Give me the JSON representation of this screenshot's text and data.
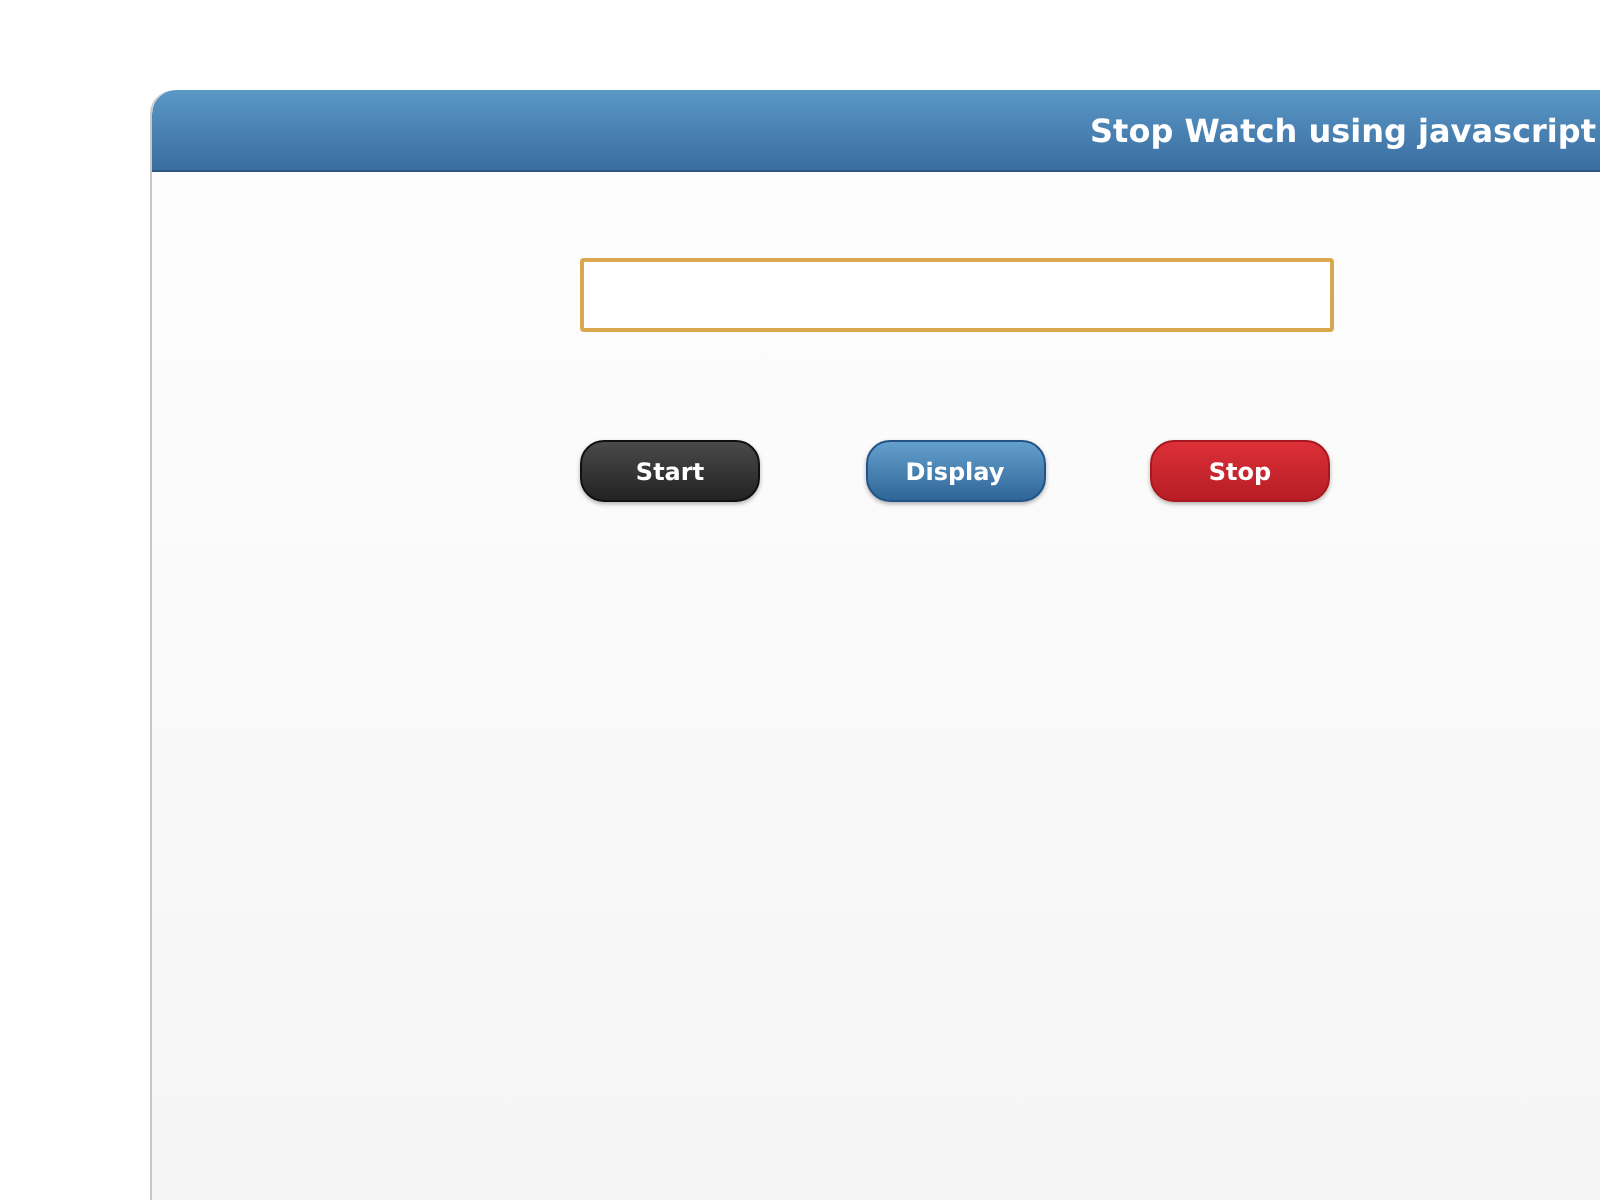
{
  "window": {
    "title": "Stop Watch using javascript"
  },
  "buttons": [
    {
      "label": "Start",
      "kind": "dark"
    },
    {
      "label": "Display",
      "kind": "blue"
    },
    {
      "label": "Stop",
      "kind": "red"
    }
  ]
}
